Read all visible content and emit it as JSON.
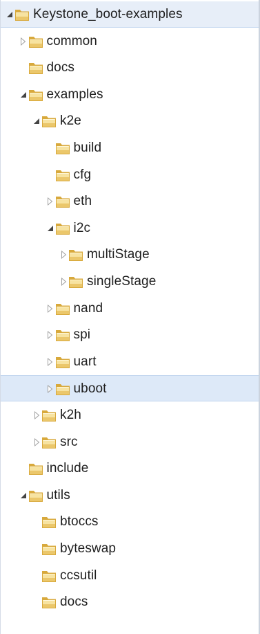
{
  "tree": {
    "items": [
      {
        "label": "Keystone_boot-examples",
        "depth": 0,
        "toggle": "expanded",
        "selected": true
      },
      {
        "label": "common",
        "depth": 1,
        "toggle": "collapsed"
      },
      {
        "label": "docs",
        "depth": 1,
        "toggle": "none"
      },
      {
        "label": "examples",
        "depth": 1,
        "toggle": "expanded"
      },
      {
        "label": "k2e",
        "depth": 2,
        "toggle": "expanded"
      },
      {
        "label": "build",
        "depth": 3,
        "toggle": "none"
      },
      {
        "label": "cfg",
        "depth": 3,
        "toggle": "none"
      },
      {
        "label": "eth",
        "depth": 3,
        "toggle": "collapsed"
      },
      {
        "label": "i2c",
        "depth": 3,
        "toggle": "expanded"
      },
      {
        "label": "multiStage",
        "depth": 4,
        "toggle": "collapsed"
      },
      {
        "label": "singleStage",
        "depth": 4,
        "toggle": "collapsed"
      },
      {
        "label": "nand",
        "depth": 3,
        "toggle": "collapsed"
      },
      {
        "label": "spi",
        "depth": 3,
        "toggle": "collapsed"
      },
      {
        "label": "uart",
        "depth": 3,
        "toggle": "collapsed"
      },
      {
        "label": "uboot",
        "depth": 3,
        "toggle": "collapsed",
        "selected": true
      },
      {
        "label": "k2h",
        "depth": 2,
        "toggle": "collapsed"
      },
      {
        "label": "src",
        "depth": 2,
        "toggle": "collapsed"
      },
      {
        "label": "include",
        "depth": 1,
        "toggle": "none"
      },
      {
        "label": "utils",
        "depth": 1,
        "toggle": "expanded"
      },
      {
        "label": "btoccs",
        "depth": 2,
        "toggle": "none"
      },
      {
        "label": "byteswap",
        "depth": 2,
        "toggle": "none"
      },
      {
        "label": "ccsutil",
        "depth": 2,
        "toggle": "none"
      },
      {
        "label": "docs",
        "depth": 2,
        "toggle": "none"
      }
    ]
  },
  "icons": {
    "folder": "folder-icon",
    "expanded": "expanded-arrow-icon",
    "collapsed": "collapsed-arrow-icon"
  },
  "colors": {
    "selection_fill": "#dde9f8",
    "selection_border": "#c3d7ef",
    "folder_light": "#f7e3a1",
    "folder_dark": "#d8a93c",
    "arrow_expanded": "#444444",
    "arrow_collapsed": "#a0a0a0"
  }
}
